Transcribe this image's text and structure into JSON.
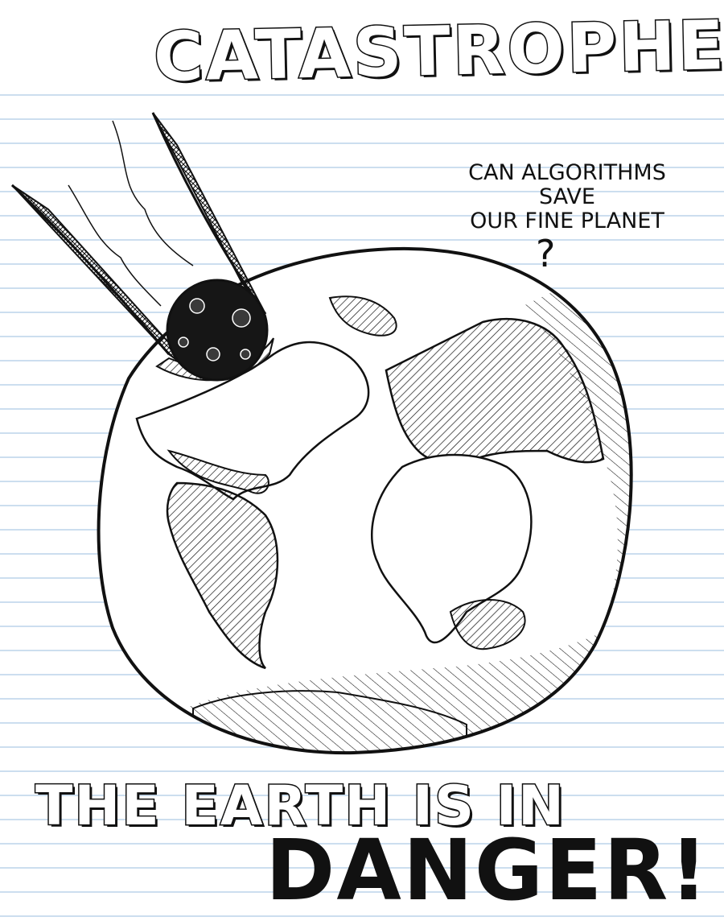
{
  "headline": "CATASTROPHE!",
  "question": {
    "line1": "CAN ALGORITHMS",
    "line2": "SAVE",
    "line3": "OUR FINE PLANET",
    "mark": "?"
  },
  "subtitle": "THE EARTH IS IN",
  "danger": "DANGER!",
  "colors": {
    "paper": "#ffffff",
    "rule_line": "#bcd3ea",
    "ink": "#111111"
  },
  "icons": [
    "meteor-icon",
    "earth-globe-icon"
  ]
}
